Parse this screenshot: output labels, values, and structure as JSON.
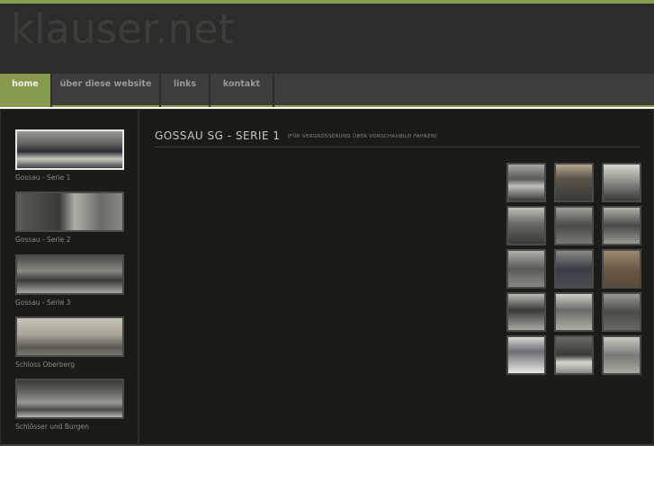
{
  "site": {
    "logo": "klauser.net"
  },
  "nav": [
    {
      "label": "home",
      "active": true
    },
    {
      "label": "über diese website"
    },
    {
      "label": "links"
    },
    {
      "label": "kontakt"
    }
  ],
  "sidebar": [
    {
      "label": "Gossau - Serie 1",
      "active": true
    },
    {
      "label": "Gossau - Serie 2"
    },
    {
      "label": "Gossau - Serie 3"
    },
    {
      "label": "Schloss Oberberg"
    },
    {
      "label": "Schlösser und Burgen"
    }
  ],
  "main": {
    "title": "GOSSAU SG - SERIE 1",
    "hint": "[FÜR VERGRÖSSERUNG ÜBER VORSCHAUBILD FAHREN]",
    "thumbnail_count": 15
  },
  "colors": {
    "accent": "#869a4d",
    "header": "#2c2c2a",
    "content": "#1b1b17"
  }
}
